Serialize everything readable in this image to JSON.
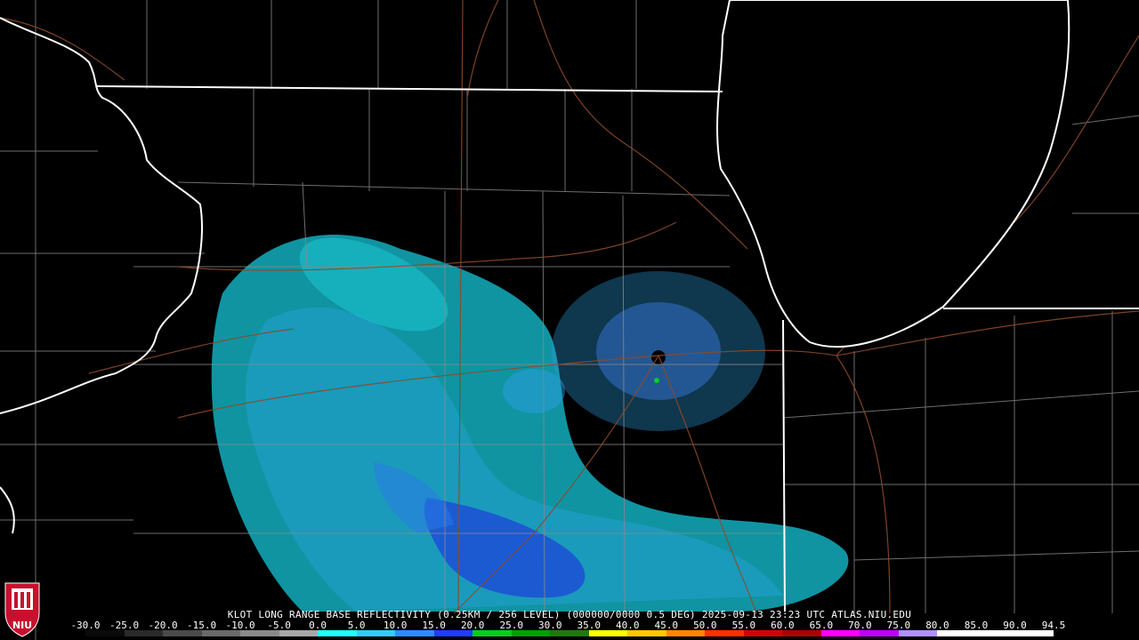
{
  "title": "KLOT LONG RANGE BASE REFLECTIVITY (0.25KM / 256 LEVEL) (000000/0000 0.5 DEG) 2025-09-13 23:23 UTC  ATLAS.NIU.EDU",
  "logo": {
    "text": "NIU",
    "icon": "niu-shield-icon",
    "color": "#c8102e"
  },
  "scale": {
    "labels": [
      "-30.0",
      "-25.0",
      "-20.0",
      "-15.0",
      "-10.0",
      "-5.0",
      "0.0",
      "5.0",
      "10.0",
      "15.0",
      "20.0",
      "25.0",
      "30.0",
      "35.0",
      "40.0",
      "45.0",
      "50.0",
      "55.0",
      "60.0",
      "65.0",
      "70.0",
      "75.0",
      "80.0",
      "85.0",
      "90.0",
      "94.5"
    ],
    "colors": [
      "#0a0a0a",
      "#2a2a2a",
      "#4a4a4a",
      "#6a6a6a",
      "#8a8a8a",
      "#a8a8a8",
      "#22ffff",
      "#33ccff",
      "#2f8cff",
      "#1f3cff",
      "#00d020",
      "#00a000",
      "#1e7a0a",
      "#ffff00",
      "#ffc800",
      "#ff8800",
      "#ff3000",
      "#d80000",
      "#b00000",
      "#ff00ff",
      "#c000ff",
      "#b090ff",
      "#ffffff",
      "#ffffff",
      "#ffffff"
    ]
  },
  "map": {
    "colors": {
      "background": "#000000",
      "state_lines": "#ffffff",
      "county_lines": "#8a8a8a",
      "highways": "#8b4a2a",
      "lake": "#000000"
    },
    "radar_site": "KLOT"
  }
}
